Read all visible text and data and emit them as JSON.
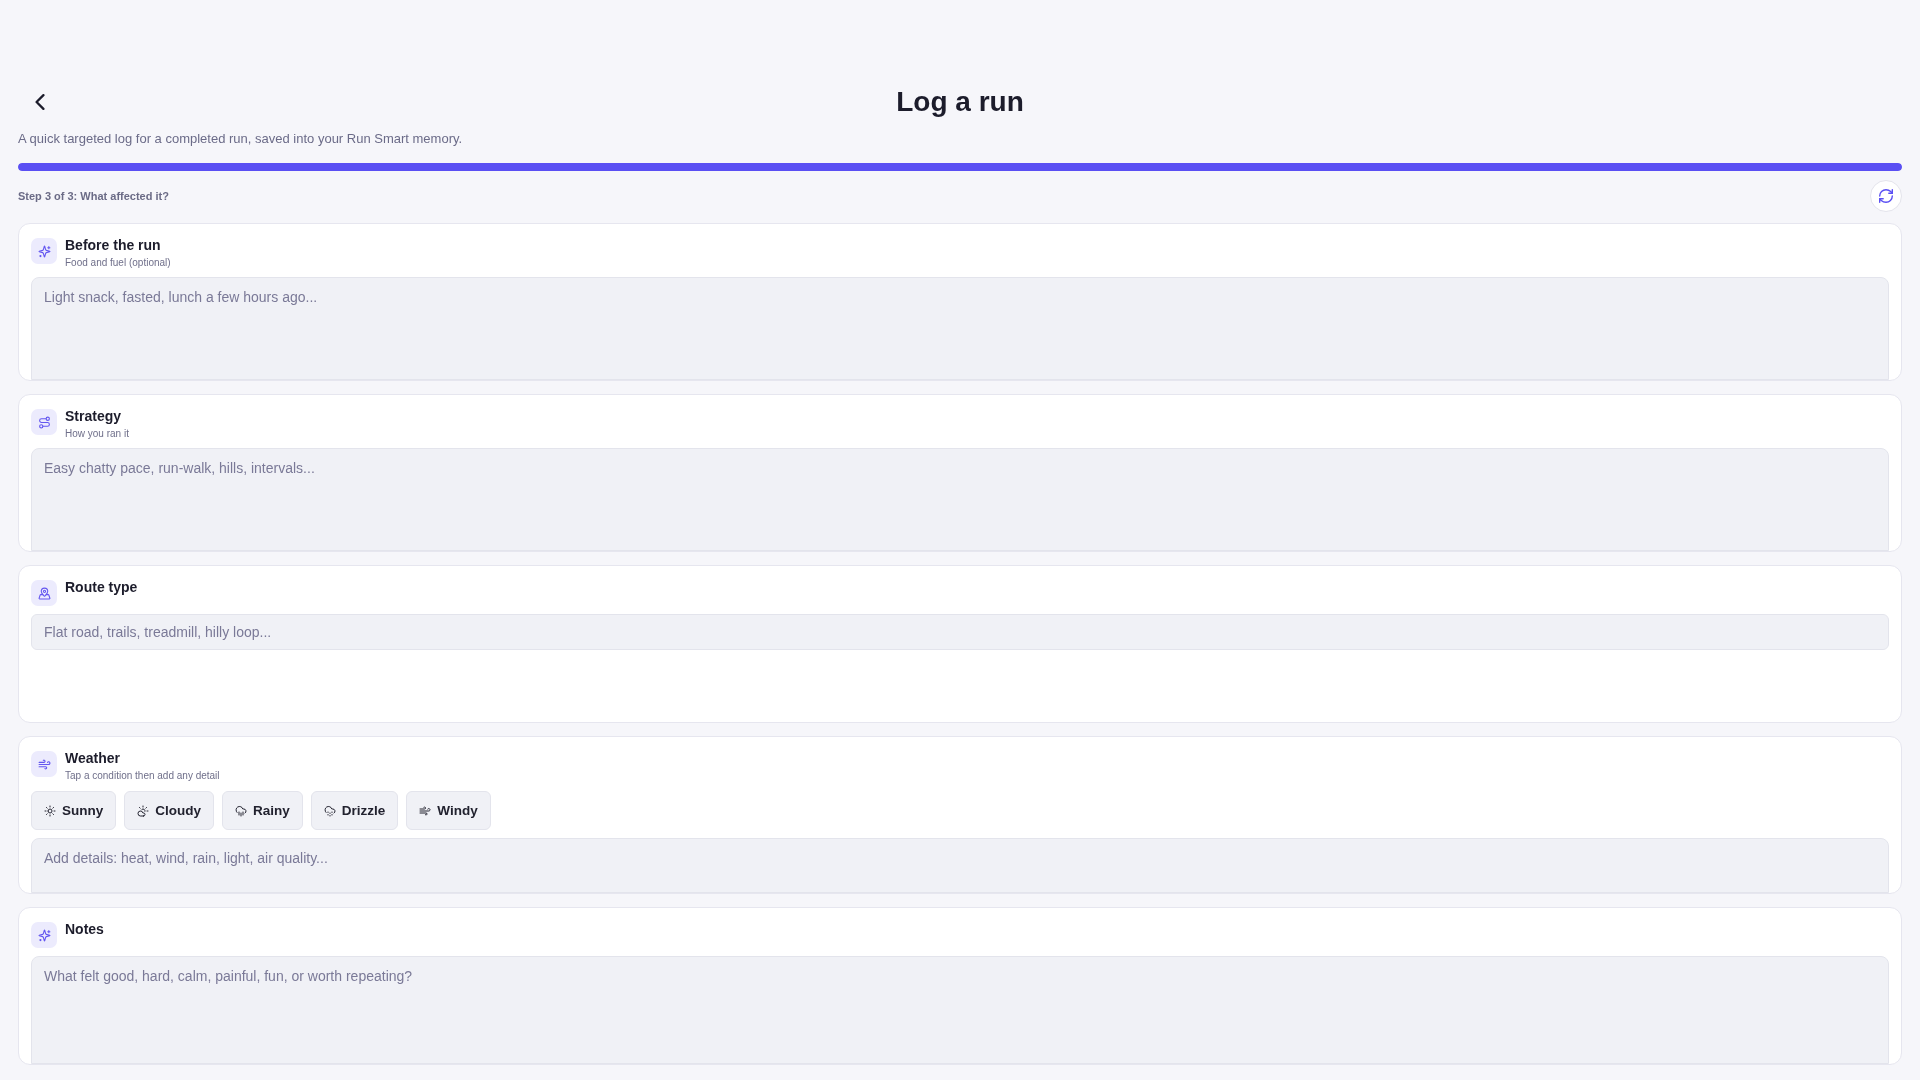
{
  "header": {
    "title": "Log a run",
    "subtitle": "A quick targeted log for a completed run, saved into your Run Smart memory."
  },
  "progress": {
    "level": 1,
    "step_label": "Step 3 of 3: What affected it?"
  },
  "sections": [
    {
      "title": "Before the run",
      "hint": "Food and fuel (optional)",
      "field": {
        "kind": "multiline",
        "placeholder": "Light snack, fasted, lunch a few hours ago..."
      }
    },
    {
      "title": "Strategy",
      "hint": "How you ran it",
      "field": {
        "kind": "multiline",
        "placeholder": "Easy chatty pace, run-walk, hills, intervals..."
      }
    },
    {
      "title": "Route type",
      "field": {
        "kind": "single_line",
        "placeholder": "Flat road, trails, treadmill, hilly loop..."
      }
    },
    {
      "title": "Weather",
      "hint": "Tap a condition then add any detail",
      "options": [
        {
          "label": "Sunny",
          "selected": false
        },
        {
          "label": "Cloudy",
          "selected": false
        },
        {
          "label": "Rainy",
          "selected": false
        },
        {
          "label": "Drizzle",
          "selected": false
        },
        {
          "label": "Windy",
          "selected": false
        }
      ],
      "field": {
        "kind": "multiline",
        "placeholder": "Add details: heat, wind, rain, light, air quality..."
      }
    },
    {
      "title": "Notes",
      "field": {
        "kind": "multiline",
        "placeholder": "What felt good, hard, calm, painful, fun, or worth repeating?"
      }
    }
  ]
}
